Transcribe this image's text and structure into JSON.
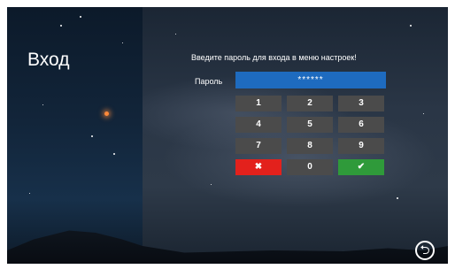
{
  "left_panel": {
    "title": "Вход"
  },
  "main": {
    "prompt": "Введите пароль для входа в меню настроек!",
    "password_label": "Пароль",
    "password_value": "******",
    "keypad": {
      "k1": "1",
      "k2": "2",
      "k3": "3",
      "k4": "4",
      "k5": "5",
      "k6": "6",
      "k7": "7",
      "k8": "8",
      "k9": "9",
      "k0": "0",
      "cancel": "✖",
      "ok": "✔"
    }
  },
  "back_button": "⮌",
  "colors": {
    "password_field": "#1e6bbf",
    "key": "#4b4b4b",
    "cancel": "#e3211c",
    "ok": "#2f9a3a"
  },
  "icons": [
    "close-icon",
    "check-icon",
    "back-arrow-icon"
  ]
}
